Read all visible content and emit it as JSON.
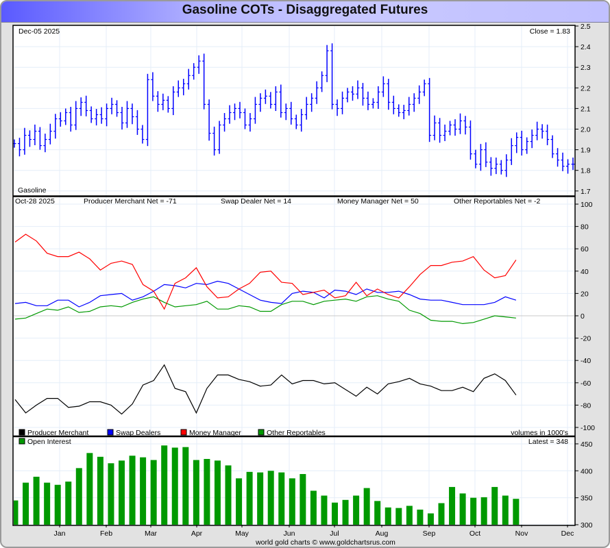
{
  "title": "Gasoline COTs - Disaggregated Futures",
  "footer": "world gold charts © www.goldchartsrus.com",
  "colors": {
    "producer": "#000000",
    "swap": "#0000ff",
    "money": "#ff0000",
    "other": "#009900",
    "price": "#0000ff",
    "oi": "#009900"
  },
  "x_months": [
    "Jan",
    "Feb",
    "Mar",
    "Apr",
    "May",
    "Jun",
    "Jul",
    "Aug",
    "Sep",
    "Oct",
    "Nov",
    "Dec"
  ],
  "chart_data": [
    {
      "type": "line",
      "panel": "price",
      "date_label": "Dec-05  2025",
      "close_label": "Close = 1.83",
      "series_label": "Gasoline",
      "yticks": [
        "2.5",
        "2.4",
        "2.3",
        "2.2",
        "2.1",
        "2.0",
        "1.9",
        "1.8",
        "1.7"
      ],
      "ylim": [
        1.7,
        2.5
      ],
      "closes": [
        1.93,
        1.9,
        1.97,
        1.95,
        1.99,
        1.92,
        1.95,
        1.99,
        2.05,
        2.04,
        2.08,
        2.02,
        2.1,
        2.13,
        2.09,
        2.05,
        2.07,
        2.05,
        2.1,
        2.12,
        2.08,
        2.03,
        2.1,
        2.06,
        2.0,
        1.95,
        2.24,
        2.16,
        2.12,
        2.14,
        2.1,
        2.18,
        2.2,
        2.22,
        2.26,
        2.3,
        2.33,
        2.12,
        1.98,
        1.9,
        2.02,
        2.05,
        2.08,
        2.1,
        2.08,
        2.02,
        2.05,
        2.12,
        2.15,
        2.16,
        2.12,
        2.18,
        2.08,
        2.1,
        2.05,
        2.02,
        2.07,
        2.12,
        2.15,
        2.2,
        2.26,
        2.38,
        2.12,
        2.1,
        2.15,
        2.18,
        2.17,
        2.2,
        2.15,
        2.12,
        2.13,
        2.18,
        2.22,
        2.13,
        2.1,
        2.08,
        2.09,
        2.12,
        2.15,
        2.18,
        2.22,
        1.97,
        2.03,
        1.97,
        1.99,
        2.02,
        2.0,
        2.04,
        2.01,
        1.88,
        1.83,
        1.9,
        1.84,
        1.81,
        1.83,
        1.8,
        1.85,
        1.92,
        1.96,
        1.9,
        1.94,
        1.97,
        2.0,
        1.99,
        1.95,
        1.88,
        1.85,
        1.82,
        1.83,
        1.83
      ]
    },
    {
      "type": "line",
      "panel": "cot-net",
      "date_label": "Oct-28  2025",
      "net_labels": [
        "Producer Merchant Net = -71",
        "Swap Dealer Net = 14",
        "Money Manager Net = 50",
        "Other Reportables Net = -2"
      ],
      "yticks": [
        "100",
        "80",
        "60",
        "40",
        "20",
        "0",
        "-20",
        "-40",
        "-60",
        "-80",
        "-100"
      ],
      "ylim": [
        -100,
        100
      ],
      "volume_note": "volumes in 1000's",
      "series": [
        {
          "name": "Producer Merchant",
          "values": [
            -75,
            -87,
            -80,
            -74,
            -74,
            -82,
            -81,
            -77,
            -77,
            -80,
            -88,
            -79,
            -62,
            -58,
            -44,
            -65,
            -68,
            -87,
            -65,
            -53,
            -53,
            -57,
            -59,
            -63,
            -62,
            -53,
            -61,
            -58,
            -58,
            -61,
            -60,
            -66,
            -72,
            -64,
            -70,
            -61,
            -59,
            -56,
            -61,
            -63,
            -67,
            -67,
            -64,
            -68,
            -56,
            -52,
            -58,
            -71
          ]
        },
        {
          "name": "Swap Dealers",
          "values": [
            11,
            12,
            9,
            9,
            14,
            14,
            8,
            12,
            18,
            19,
            20,
            14,
            17,
            22,
            28,
            27,
            25,
            29,
            28,
            31,
            29,
            24,
            19,
            14,
            12,
            11,
            20,
            22,
            21,
            16,
            23,
            22,
            19,
            24,
            21,
            21,
            22,
            19,
            15,
            14,
            14,
            12,
            10,
            10,
            10,
            12,
            17,
            14
          ]
        },
        {
          "name": "Money Manager",
          "values": [
            66,
            73,
            67,
            56,
            53,
            53,
            57,
            51,
            41,
            47,
            49,
            46,
            28,
            22,
            6,
            29,
            34,
            43,
            26,
            16,
            17,
            24,
            29,
            39,
            40,
            30,
            29,
            19,
            21,
            23,
            16,
            18,
            30,
            18,
            24,
            19,
            16,
            26,
            37,
            45,
            45,
            48,
            49,
            53,
            41,
            34,
            36,
            50
          ]
        },
        {
          "name": "Other Reportables",
          "values": [
            -3,
            -2,
            2,
            6,
            5,
            8,
            3,
            4,
            8,
            9,
            8,
            12,
            15,
            17,
            12,
            8,
            9,
            10,
            13,
            6,
            6,
            9,
            8,
            4,
            4,
            10,
            13,
            13,
            10,
            13,
            14,
            15,
            13,
            17,
            18,
            15,
            13,
            5,
            2,
            -4,
            -5,
            -5,
            -7,
            -6,
            -3,
            0,
            -1,
            -2
          ]
        }
      ]
    },
    {
      "type": "bar",
      "panel": "open-interest",
      "series_label": "Open Interest",
      "latest_label": "Latest = 348",
      "yticks": [
        "450",
        "400",
        "350",
        "300"
      ],
      "ylim": [
        300,
        460
      ],
      "values": [
        345,
        378,
        389,
        378,
        374,
        380,
        405,
        433,
        426,
        414,
        419,
        428,
        425,
        420,
        447,
        443,
        444,
        420,
        422,
        419,
        410,
        386,
        398,
        397,
        400,
        397,
        386,
        394,
        363,
        354,
        341,
        346,
        354,
        368,
        344,
        332,
        331,
        335,
        328,
        321,
        340,
        370,
        358,
        350,
        351,
        370,
        354,
        348
      ]
    }
  ]
}
